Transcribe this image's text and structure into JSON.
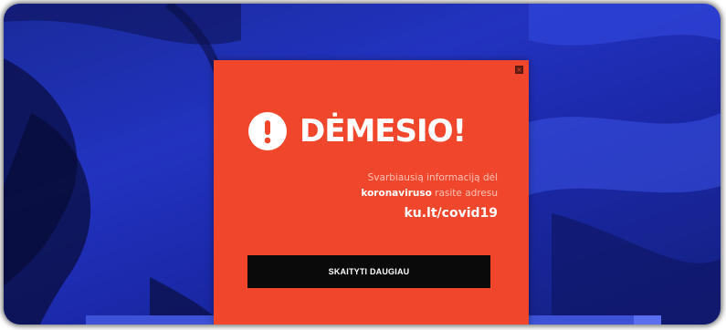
{
  "modal": {
    "close_glyph": "×",
    "title": "DĖMESIO!",
    "icon": "exclamation-circle-icon",
    "info_line1": "Svarbiausią informaciją dėl",
    "info_bold": "koronaviruso",
    "info_line2_rest": " rasite adresu",
    "link_text": "ku.lt/covid19",
    "button_label": "SKAITYTI DAUGIAU"
  },
  "colors": {
    "modal_bg": "#f0462c",
    "page_bg": "#2233c0",
    "button_bg": "#0a0a0a"
  }
}
